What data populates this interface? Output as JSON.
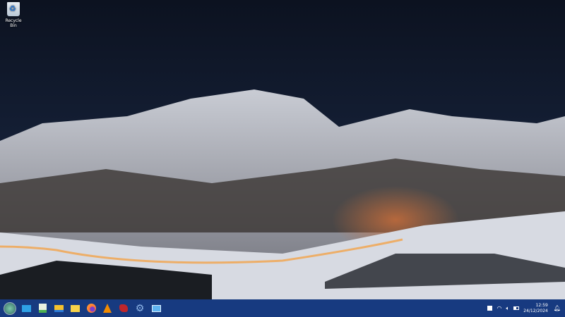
{
  "desktop": {
    "icons": [
      {
        "label": "Recycle Bin",
        "icon": "recycle-bin-icon"
      }
    ]
  },
  "taskbar": {
    "apps": [
      {
        "name": "start-menu",
        "icon": "start-orb-icon",
        "color": "#4a9a7a"
      },
      {
        "name": "desktop",
        "icon": "show-desktop-icon",
        "color": "#2ea1e6"
      },
      {
        "name": "text-editor",
        "icon": "text-editor-icon",
        "color": "#4caf50"
      },
      {
        "name": "file-manager",
        "icon": "folder-icon",
        "color": "#f5c12e"
      },
      {
        "name": "files",
        "icon": "folder-icon",
        "color": "#f7d34a"
      },
      {
        "name": "firefox",
        "icon": "firefox-icon",
        "color": "#ff7139"
      },
      {
        "name": "vlc",
        "icon": "vlc-icon",
        "color": "#f08a00"
      },
      {
        "name": "app",
        "icon": "red-app-icon",
        "color": "#c0262b"
      },
      {
        "name": "settings",
        "icon": "gear-icon",
        "color": "#8fb6e8"
      },
      {
        "name": "remote-desktop",
        "icon": "remote-desktop-icon",
        "color": "#5fb4f0"
      }
    ],
    "clock": {
      "time": "12:59",
      "date": "24/12/2024"
    }
  }
}
